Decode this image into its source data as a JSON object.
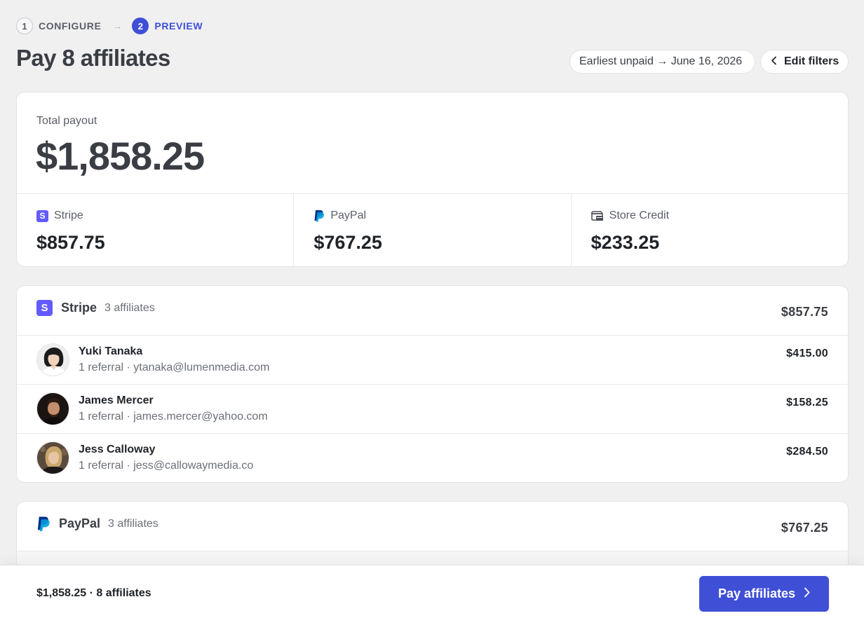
{
  "stepper": {
    "steps": [
      {
        "number": "1",
        "label": "CONFIGURE",
        "state": "done"
      },
      {
        "number": "2",
        "label": "PREVIEW",
        "state": "active"
      }
    ],
    "arrow": "→"
  },
  "header": {
    "title": "Pay 8 affiliates",
    "date_pill": "Earliest unpaid → June 16, 2026",
    "edit_filters": "Edit filters"
  },
  "total": {
    "label": "Total payout",
    "amount": "$1,858.25",
    "methods": [
      {
        "name": "Stripe",
        "amount": "$857.75",
        "icon": "stripe-icon"
      },
      {
        "name": "PayPal",
        "amount": "$767.25",
        "icon": "paypal-icon"
      },
      {
        "name": "Store Credit",
        "amount": "$233.25",
        "icon": "store-credit-icon"
      }
    ]
  },
  "groups": {
    "stripe": {
      "name": "Stripe",
      "count": "3 affiliates",
      "amount": "$857.75",
      "icon_letter": "S",
      "affiliates": [
        {
          "name": "Yuki Tanaka",
          "sub": "1 referral · ytanaka@lumenmedia.com",
          "amount": "$415.00"
        },
        {
          "name": "James Mercer",
          "sub": "1 referral · james.mercer@yahoo.com",
          "amount": "$158.25"
        },
        {
          "name": "Jess Calloway",
          "sub": "1 referral · jess@callowaymedia.co",
          "amount": "$284.50"
        }
      ]
    },
    "paypal": {
      "name": "PayPal",
      "count": "3 affiliates",
      "amount": "$767.25"
    }
  },
  "footer": {
    "summary": "$1,858.25 · 8 affiliates",
    "pay_button": "Pay affiliates"
  },
  "colors": {
    "accent": "#3f4fd6",
    "stripe": "#635bff",
    "paypal_dark": "#003087",
    "paypal_light": "#009cde"
  }
}
